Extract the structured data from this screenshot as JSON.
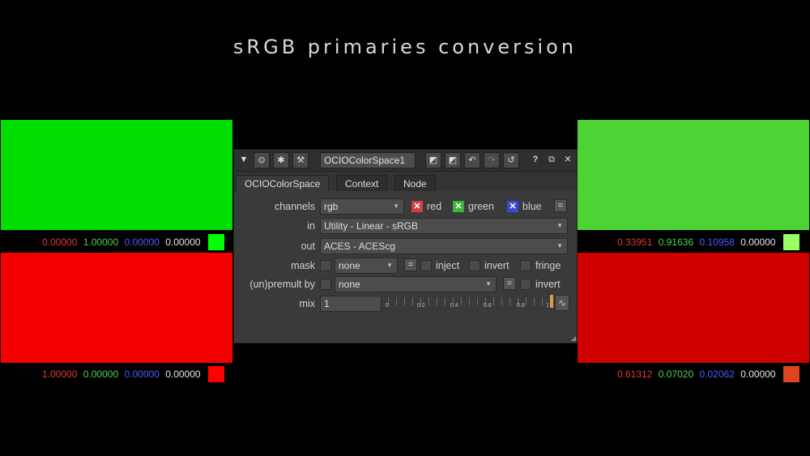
{
  "title": "sRGB primaries conversion",
  "left": {
    "green": {
      "color": "#00dd00",
      "values": [
        "0.00000",
        "1.00000",
        "0.00000",
        "0.00000"
      ],
      "chip": "#00ff00"
    },
    "red": {
      "color": "#f40000",
      "values": [
        "1.00000",
        "0.00000",
        "0.00000",
        "0.00000"
      ],
      "chip": "#ff0000"
    }
  },
  "right": {
    "green": {
      "color": "#4cd434",
      "values": [
        "0.33951",
        "0.91636",
        "0.10958",
        "0.00000"
      ],
      "chip": "#99ff66"
    },
    "red": {
      "color": "#d10000",
      "values": [
        "0.61312",
        "0.07020",
        "0.02062",
        "0.00000"
      ],
      "chip": "#dd4422"
    }
  },
  "panel": {
    "node_name": "OCIOColorSpace1",
    "tabs": [
      "OCIOColorSpace",
      "Context",
      "Node"
    ],
    "channels_label": "channels",
    "channels_value": "rgb",
    "ch_red": "red",
    "ch_green": "green",
    "ch_blue": "blue",
    "in_label": "in",
    "in_value": "Utility - Linear - sRGB",
    "out_label": "out",
    "out_value": "ACES - ACEScg",
    "mask_label": "mask",
    "mask_value": "none",
    "inject": "inject",
    "invert": "invert",
    "fringe": "fringe",
    "premult_label": "(un)premult by",
    "premult_value": "none",
    "premult_invert": "invert",
    "mix_label": "mix",
    "mix_value": "1",
    "slider_ticks": [
      "0",
      "0.2",
      "0.4",
      "0.6",
      "0.8",
      "1"
    ],
    "eq": "="
  }
}
